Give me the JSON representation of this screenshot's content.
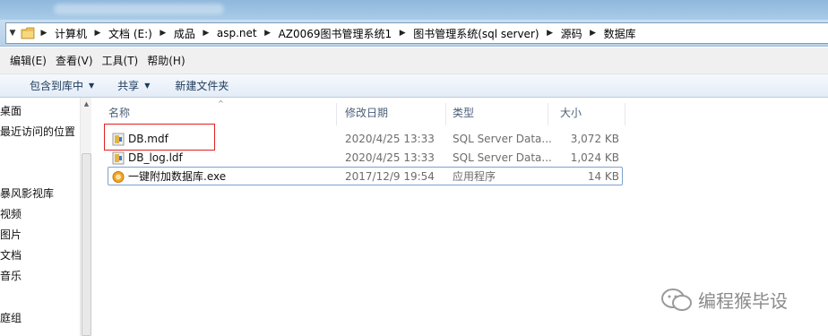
{
  "address_bar": {
    "crumbs": [
      "计算机",
      "文档 (E:)",
      "成品",
      "asp.net",
      "AZ0069图书管理系统1",
      "图书管理系统(sql server)",
      "源码",
      "数据库"
    ]
  },
  "menu": {
    "items": [
      "编辑(E)",
      "查看(V)",
      "工具(T)",
      "帮助(H)"
    ]
  },
  "commands": {
    "include_in_library": "包含到库中",
    "share": "共享",
    "new_folder": "新建文件夹"
  },
  "nav_pane": {
    "items": [
      "桌面",
      "最近访问的位置",
      "暴风影视库",
      "视频",
      "图片",
      "文档",
      "音乐",
      "庭组"
    ]
  },
  "columns": {
    "name": "名称",
    "modified": "修改日期",
    "type": "类型",
    "size": "大小"
  },
  "files": [
    {
      "name": "DB.mdf",
      "modified": "2020/4/25 13:33",
      "type": "SQL Server Data...",
      "size": "3,072 KB",
      "icon": "database-file-icon"
    },
    {
      "name": "DB_log.ldf",
      "modified": "2020/4/25 13:33",
      "type": "SQL Server Data...",
      "size": "1,024 KB",
      "icon": "database-file-icon"
    },
    {
      "name": "一键附加数据库.exe",
      "modified": "2017/12/9 19:54",
      "type": "应用程序",
      "size": "14 KB",
      "icon": "application-exe-icon"
    }
  ],
  "watermark": {
    "text": "编程猴毕设"
  },
  "colors": {
    "highlight_border": "#e02020",
    "focus_border": "#7da2ce",
    "header_text": "#4c607a"
  }
}
